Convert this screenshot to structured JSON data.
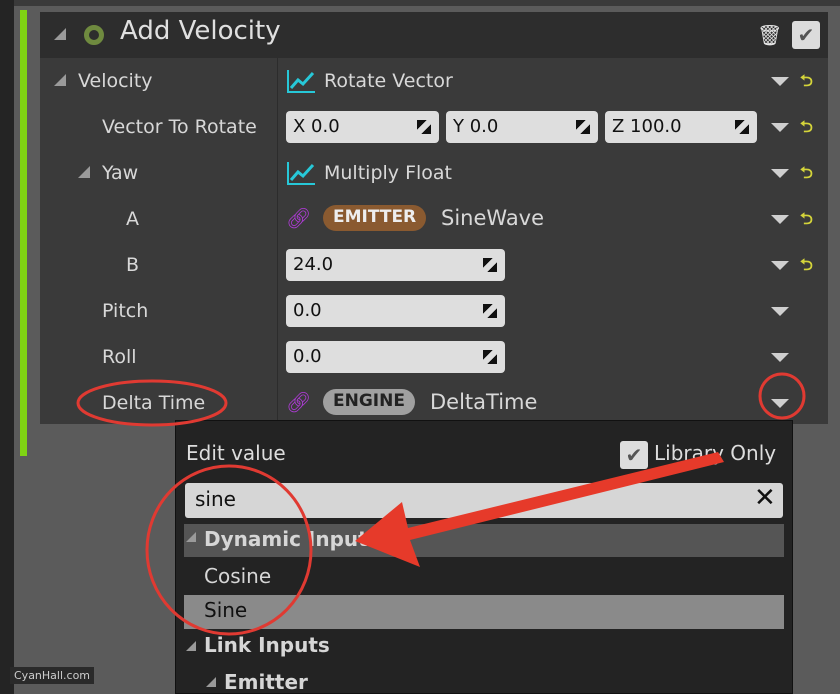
{
  "module": {
    "title": "Add Velocity"
  },
  "rows": [
    {
      "label": "Velocity",
      "value": "Rotate Vector"
    },
    {
      "label": "Vector To Rotate",
      "x": "X  0.0",
      "y": "Y  0.0",
      "z": "Z  100.0"
    },
    {
      "label": "Yaw",
      "value": "Multiply Float"
    },
    {
      "label": "A",
      "badge": "EMITTER",
      "value": "SineWave"
    },
    {
      "label": "B",
      "value": "24.0"
    },
    {
      "label": "Pitch",
      "value": "0.0"
    },
    {
      "label": "Roll",
      "value": "0.0"
    },
    {
      "label": "Delta Time",
      "badge": "ENGINE",
      "value": "DeltaTime"
    }
  ],
  "popup": {
    "title": "Edit value",
    "library_only": "Library Only",
    "search_value": "sine",
    "items": [
      "Dynamic Inputs",
      "Cosine",
      "Sine",
      "Link Inputs",
      "Emitter"
    ]
  },
  "watermark": "CyanHall.com",
  "colors": {
    "accent_green": "#7fd313",
    "emitter_badge": "#8a5a30",
    "engine_badge": "#9a9a9a",
    "annotation": "#e03a32"
  }
}
